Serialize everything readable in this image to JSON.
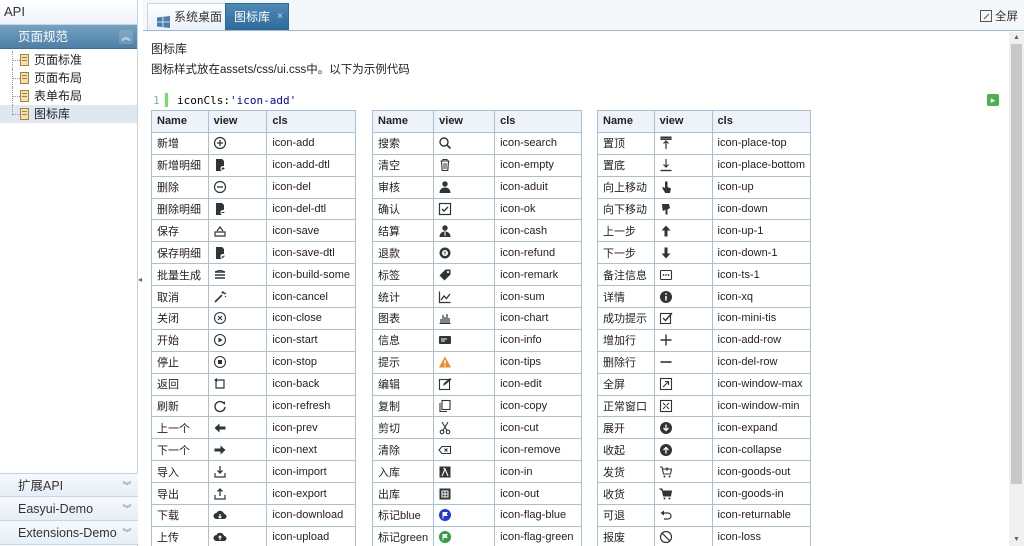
{
  "sidebar": {
    "title": "API",
    "sections": [
      {
        "label": "页面规范",
        "active": true
      },
      {
        "label": "扩展API"
      },
      {
        "label": "Easyui-Demo"
      },
      {
        "label": "Extensions-Demo"
      }
    ],
    "tree": [
      "页面标准",
      "页面布局",
      "表单布局",
      "图标库"
    ]
  },
  "tabs": [
    {
      "label": "系统桌面"
    },
    {
      "label": "图标库"
    }
  ],
  "fullscreen_label": "全屏",
  "content": {
    "title": "图标库",
    "description": "图标样式放在assets/css/ui.css中。以下为示例代码",
    "code_line_no": "1",
    "code_key": "iconCls:",
    "code_value": "'icon-add'"
  },
  "table_headers": [
    "Name",
    "view",
    "cls"
  ],
  "tables": [
    [
      {
        "name": "新增",
        "icon": "plus-circle",
        "cls": "icon-add"
      },
      {
        "name": "新增明细",
        "icon": "doc-plus",
        "cls": "icon-add-dtl"
      },
      {
        "name": "删除",
        "icon": "minus-circle",
        "cls": "icon-del"
      },
      {
        "name": "删除明细",
        "icon": "doc-minus",
        "cls": "icon-del-dtl"
      },
      {
        "name": "保存",
        "icon": "save",
        "cls": "icon-save"
      },
      {
        "name": "保存明细",
        "icon": "doc-save",
        "cls": "icon-save-dtl"
      },
      {
        "name": "批量生成",
        "icon": "stack",
        "cls": "icon-build-some"
      },
      {
        "name": "取消",
        "icon": "wand",
        "cls": "icon-cancel"
      },
      {
        "name": "关闭",
        "icon": "x-circle",
        "cls": "icon-close"
      },
      {
        "name": "开始",
        "icon": "play",
        "cls": "icon-start"
      },
      {
        "name": "停止",
        "icon": "stop",
        "cls": "icon-stop"
      },
      {
        "name": "返回",
        "icon": "back",
        "cls": "icon-back"
      },
      {
        "name": "刷新",
        "icon": "refresh",
        "cls": "icon-refresh"
      },
      {
        "name": "上一个",
        "icon": "arrow-left",
        "cls": "icon-prev"
      },
      {
        "name": "下一个",
        "icon": "arrow-right",
        "cls": "icon-next"
      },
      {
        "name": "导入",
        "icon": "import",
        "cls": "icon-import"
      },
      {
        "name": "导出",
        "icon": "export",
        "cls": "icon-export"
      },
      {
        "name": "下载",
        "icon": "cloud-down",
        "cls": "icon-download"
      },
      {
        "name": "上传",
        "icon": "cloud-up",
        "cls": "icon-upload"
      }
    ],
    [
      {
        "name": "搜索",
        "icon": "search",
        "cls": "icon-search"
      },
      {
        "name": "清空",
        "icon": "trash",
        "cls": "icon-empty"
      },
      {
        "name": "审核",
        "icon": "user",
        "cls": "icon-aduit"
      },
      {
        "name": "确认",
        "icon": "check-box",
        "cls": "icon-ok"
      },
      {
        "name": "结算",
        "icon": "user-cash",
        "cls": "icon-cash"
      },
      {
        "name": "退款",
        "icon": "refund",
        "cls": "icon-refund"
      },
      {
        "name": "标签",
        "icon": "tag",
        "cls": "icon-remark"
      },
      {
        "name": "统计",
        "icon": "line-chart",
        "cls": "icon-sum"
      },
      {
        "name": "图表",
        "icon": "bar-chart",
        "cls": "icon-chart"
      },
      {
        "name": "信息",
        "icon": "card",
        "cls": "icon-info"
      },
      {
        "name": "提示",
        "icon": "warning",
        "cls": "icon-tips"
      },
      {
        "name": "编辑",
        "icon": "edit",
        "cls": "icon-edit"
      },
      {
        "name": "复制",
        "icon": "copy",
        "cls": "icon-copy"
      },
      {
        "name": "剪切",
        "icon": "scissors",
        "cls": "icon-cut"
      },
      {
        "name": "清除",
        "icon": "erase",
        "cls": "icon-remove"
      },
      {
        "name": "入库",
        "icon": "in-box",
        "cls": "icon-in"
      },
      {
        "name": "出库",
        "icon": "out-box",
        "cls": "icon-out"
      },
      {
        "name": "标记blue",
        "icon": "flag-blue",
        "cls": "icon-flag-blue"
      },
      {
        "name": "标记green",
        "icon": "flag-green",
        "cls": "icon-flag-green"
      }
    ],
    [
      {
        "name": "置顶",
        "icon": "place-top",
        "cls": "icon-place-top"
      },
      {
        "name": "置底",
        "icon": "place-bottom",
        "cls": "icon-place-bottom"
      },
      {
        "name": "向上移动",
        "icon": "hand-up",
        "cls": "icon-up"
      },
      {
        "name": "向下移动",
        "icon": "hand-down",
        "cls": "icon-down"
      },
      {
        "name": "上一步",
        "icon": "arrow-up",
        "cls": "icon-up-1"
      },
      {
        "name": "下一步",
        "icon": "arrow-down",
        "cls": "icon-down-1"
      },
      {
        "name": "备注信息",
        "icon": "dots-box",
        "cls": "icon-ts-1"
      },
      {
        "name": "详情",
        "icon": "info-circle",
        "cls": "icon-xq"
      },
      {
        "name": "成功提示",
        "icon": "check-square",
        "cls": "icon-mini-tis"
      },
      {
        "name": "增加行",
        "icon": "plus",
        "cls": "icon-add-row"
      },
      {
        "name": "删除行",
        "icon": "minus",
        "cls": "icon-del-row"
      },
      {
        "name": "全屏",
        "icon": "maximize",
        "cls": "icon-window-max"
      },
      {
        "name": "正常窗口",
        "icon": "minimize",
        "cls": "icon-window-min"
      },
      {
        "name": "展开",
        "icon": "down-circle",
        "cls": "icon-expand"
      },
      {
        "name": "收起",
        "icon": "up-circle",
        "cls": "icon-collapse"
      },
      {
        "name": "发货",
        "icon": "cart-out",
        "cls": "icon-goods-out"
      },
      {
        "name": "收货",
        "icon": "cart-in",
        "cls": "icon-goods-in"
      },
      {
        "name": "可退",
        "icon": "undo",
        "cls": "icon-returnable"
      },
      {
        "name": "报废",
        "icon": "ban",
        "cls": "icon-loss"
      }
    ]
  ]
}
